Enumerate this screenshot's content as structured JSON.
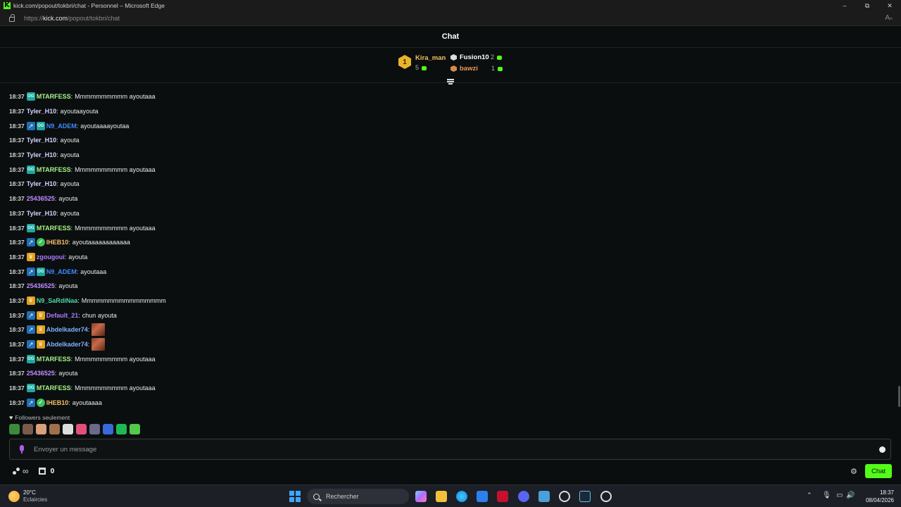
{
  "window": {
    "title": "kick.com/popout/tokbri/chat - Personnel – Microsoft Edge",
    "url_prefix": "https://",
    "url_domain": "kick.com",
    "url_path": "/popout/tokbri/chat",
    "controls": [
      "–",
      "⧉",
      "✕"
    ]
  },
  "chat": {
    "title": "Chat",
    "leaderboard": [
      {
        "rank": "1",
        "name": "Kira_man",
        "value": "5",
        "color": "#f2c15a"
      },
      {
        "rank": "2",
        "name": "Fusion10",
        "value": "2",
        "color": "#ffffff"
      },
      {
        "rank": "3",
        "name": "bawzi",
        "value": "1",
        "color": "#e79a55"
      }
    ],
    "messages": [
      {
        "time": "18:37",
        "badges": [
          "og"
        ],
        "user": "MTARFESS",
        "color": "#a6f58a",
        "text": "Mmmmmmmmmm ayoutaaa"
      },
      {
        "time": "18:37",
        "badges": [],
        "user": "Tyler_H10",
        "color": "#d4d4ff",
        "text": "ayoutaayouta"
      },
      {
        "time": "18:37",
        "badges": [
          "sword",
          "og"
        ],
        "user": "N9_ADEM",
        "color": "#3a8bff",
        "text": "ayoutaaaayoutaa"
      },
      {
        "time": "18:37",
        "badges": [],
        "user": "Tyler_H10",
        "color": "#d4d4ff",
        "text": "ayouta"
      },
      {
        "time": "18:37",
        "badges": [],
        "user": "Tyler_H10",
        "color": "#d4d4ff",
        "text": "ayouta"
      },
      {
        "time": "18:37",
        "badges": [
          "og"
        ],
        "user": "MTARFESS",
        "color": "#a6f58a",
        "text": "Mmmmmmmmmm ayoutaaa"
      },
      {
        "time": "18:37",
        "badges": [],
        "user": "Tyler_H10",
        "color": "#d4d4ff",
        "text": "ayouta"
      },
      {
        "time": "18:37",
        "badges": [],
        "user": "25436525",
        "color": "#c28cff",
        "text": "ayouta"
      },
      {
        "time": "18:37",
        "badges": [],
        "user": "Tyler_H10",
        "color": "#d4d4ff",
        "text": "ayouta"
      },
      {
        "time": "18:37",
        "badges": [
          "og"
        ],
        "user": "MTARFESS",
        "color": "#a6f58a",
        "text": "Mmmmmmmmmm ayoutaaa"
      },
      {
        "time": "18:37",
        "badges": [
          "sword",
          "verified"
        ],
        "user": "IHEB10",
        "color": "#f5c06a",
        "text": "ayoutaaaaaaaaaaaa"
      },
      {
        "time": "18:37",
        "badges": [
          "crown"
        ],
        "user": "zgougoui",
        "color": "#b07cff",
        "text": "ayouta"
      },
      {
        "time": "18:37",
        "badges": [
          "sword",
          "og"
        ],
        "user": "N9_ADEM",
        "color": "#3a8bff",
        "text": "ayoutaaa"
      },
      {
        "time": "18:37",
        "badges": [],
        "user": "25436525",
        "color": "#c28cff",
        "text": "ayouta"
      },
      {
        "time": "18:37",
        "badges": [
          "crown"
        ],
        "user": "N9_SaRdiNaa",
        "color": "#4fd9a6",
        "text": "Mmmmmmmmmmmmmmmm"
      },
      {
        "time": "18:37",
        "badges": [
          "sword",
          "crown"
        ],
        "user": "Default_21",
        "color": "#a77bff",
        "text": "chun ayouta"
      },
      {
        "time": "18:37",
        "badges": [
          "sword",
          "crown"
        ],
        "user": "Abdelkader74",
        "color": "#7fb2ff",
        "text": "",
        "emote": true
      },
      {
        "time": "18:37",
        "badges": [
          "sword",
          "crown"
        ],
        "user": "Abdelkader74",
        "color": "#7fb2ff",
        "text": "",
        "emote": true
      },
      {
        "time": "18:37",
        "badges": [
          "og"
        ],
        "user": "MTARFESS",
        "color": "#a6f58a",
        "text": "Mmmmmmmmmm ayoutaaa"
      },
      {
        "time": "18:37",
        "badges": [],
        "user": "25436525",
        "color": "#c28cff",
        "text": "ayouta"
      },
      {
        "time": "18:37",
        "badges": [
          "og"
        ],
        "user": "MTARFESS",
        "color": "#a6f58a",
        "text": "Mmmmmmmmmm ayoutaaa"
      },
      {
        "time": "18:37",
        "badges": [
          "sword",
          "verified"
        ],
        "user": "IHEB10",
        "color": "#f5c06a",
        "text": "ayoutaaaa"
      }
    ],
    "followers_only": "Followers seulement",
    "recent_emotes": [
      "frog-emote",
      "face-emote",
      "hand-emote",
      "man-emote",
      "tt-emote",
      "pink-emote",
      "cat-emote",
      "blue-emote",
      "spotify-emote",
      "alien-emote"
    ],
    "input_placeholder": "Envoyer un message",
    "points": "0",
    "send_label": "Chat",
    "accent": "#53fc18"
  },
  "taskbar": {
    "temperature": "20°C",
    "weather": "Eclaircies",
    "search_label": "Rechercher",
    "time": "18:37",
    "date": "08/04/2026"
  }
}
